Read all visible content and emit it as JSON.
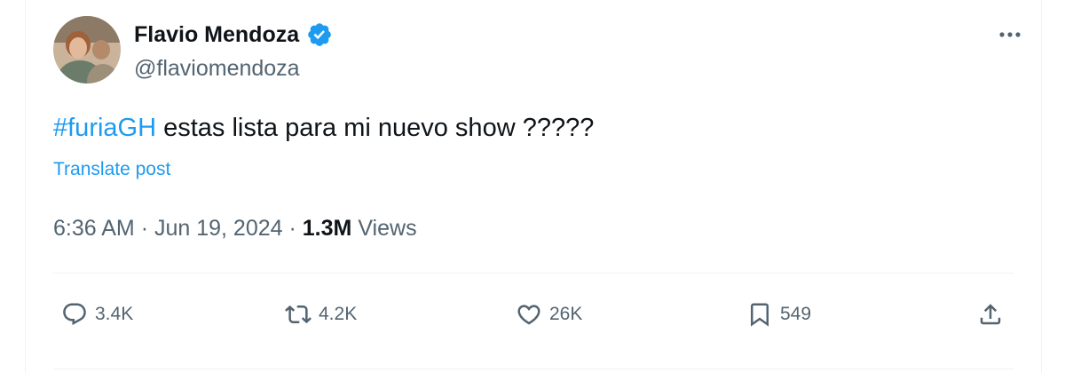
{
  "author": {
    "name": "Flavio Mendoza",
    "handle": "@flaviomendoza",
    "verified": true
  },
  "post": {
    "hashtag": "#furiaGH",
    "text": "estas lista para mi nuevo show ?????",
    "translate_label": "Translate post"
  },
  "meta": {
    "time": "6:36 AM",
    "date": "Jun 19, 2024",
    "views_count": "1.3M",
    "views_label": "Views",
    "separator": "·"
  },
  "actions": {
    "replies": "3.4K",
    "reposts": "4.2K",
    "likes": "26K",
    "bookmarks": "549"
  },
  "colors": {
    "accent": "#1d9bf0",
    "text": "#0f1419",
    "secondary": "#536471",
    "divider": "#eff3f4"
  },
  "icons": [
    "verified-badge-icon",
    "more-icon",
    "reply-icon",
    "repost-icon",
    "like-icon",
    "bookmark-icon",
    "share-icon"
  ]
}
